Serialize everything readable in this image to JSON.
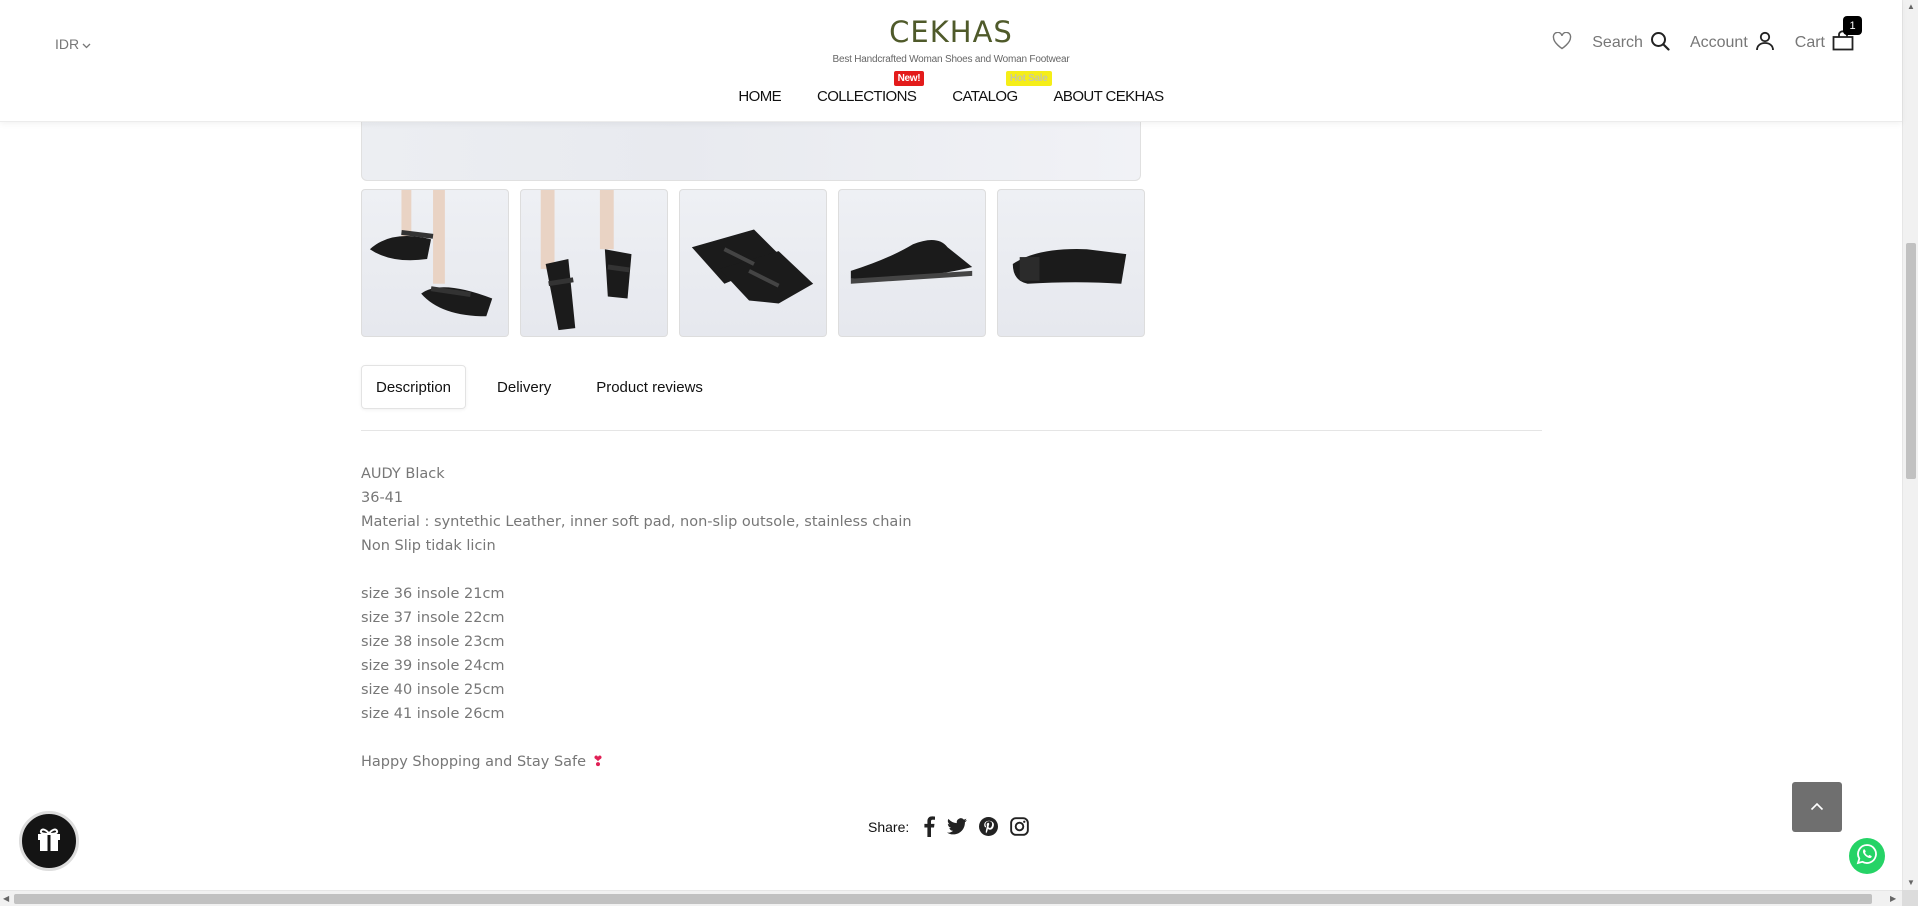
{
  "header": {
    "currency": "IDR",
    "brand": "CEKHAS",
    "tagline": "Best Handcrafted Woman Shoes and Woman Footwear",
    "nav": [
      {
        "label": "HOME",
        "badge": ""
      },
      {
        "label": "COLLECTIONS",
        "badge": "New!"
      },
      {
        "label": "CATALOG",
        "badge": "Hot Sale"
      },
      {
        "label": "ABOUT CEKHAS",
        "badge": ""
      }
    ],
    "search_label": "Search",
    "account_label": "Account",
    "cart_label": "Cart",
    "cart_count": "1"
  },
  "gallery": {
    "thumbnails": [
      "front-pair-worn",
      "side-pair-worn",
      "top-view-pair",
      "side-view-single",
      "sole-view"
    ]
  },
  "tabs": [
    {
      "label": "Description",
      "active": true
    },
    {
      "label": "Delivery",
      "active": false
    },
    {
      "label": "Product reviews",
      "active": false
    }
  ],
  "description": {
    "lines_a": [
      "AUDY Black",
      "36-41",
      "Material : syntethic Leather, inner soft pad, non-slip outsole, stainless chain",
      "Non Slip tidak licin"
    ],
    "lines_b": [
      "size 36 insole 21cm",
      "size 37 insole 22cm",
      "size 38 insole 23cm",
      "size 39 insole 24cm",
      "size 40 insole 25cm",
      "size 41 insole 26cm"
    ],
    "closing": "Happy Shopping and Stay Safe"
  },
  "share": {
    "label": "Share:",
    "icons": [
      "facebook-icon",
      "twitter-icon",
      "pinterest-icon",
      "instagram-icon"
    ]
  },
  "colors": {
    "brand": "#4f5a2a",
    "badge_new": "#e31b1b",
    "badge_hot": "#f5ee18",
    "whatsapp": "#25d366"
  }
}
